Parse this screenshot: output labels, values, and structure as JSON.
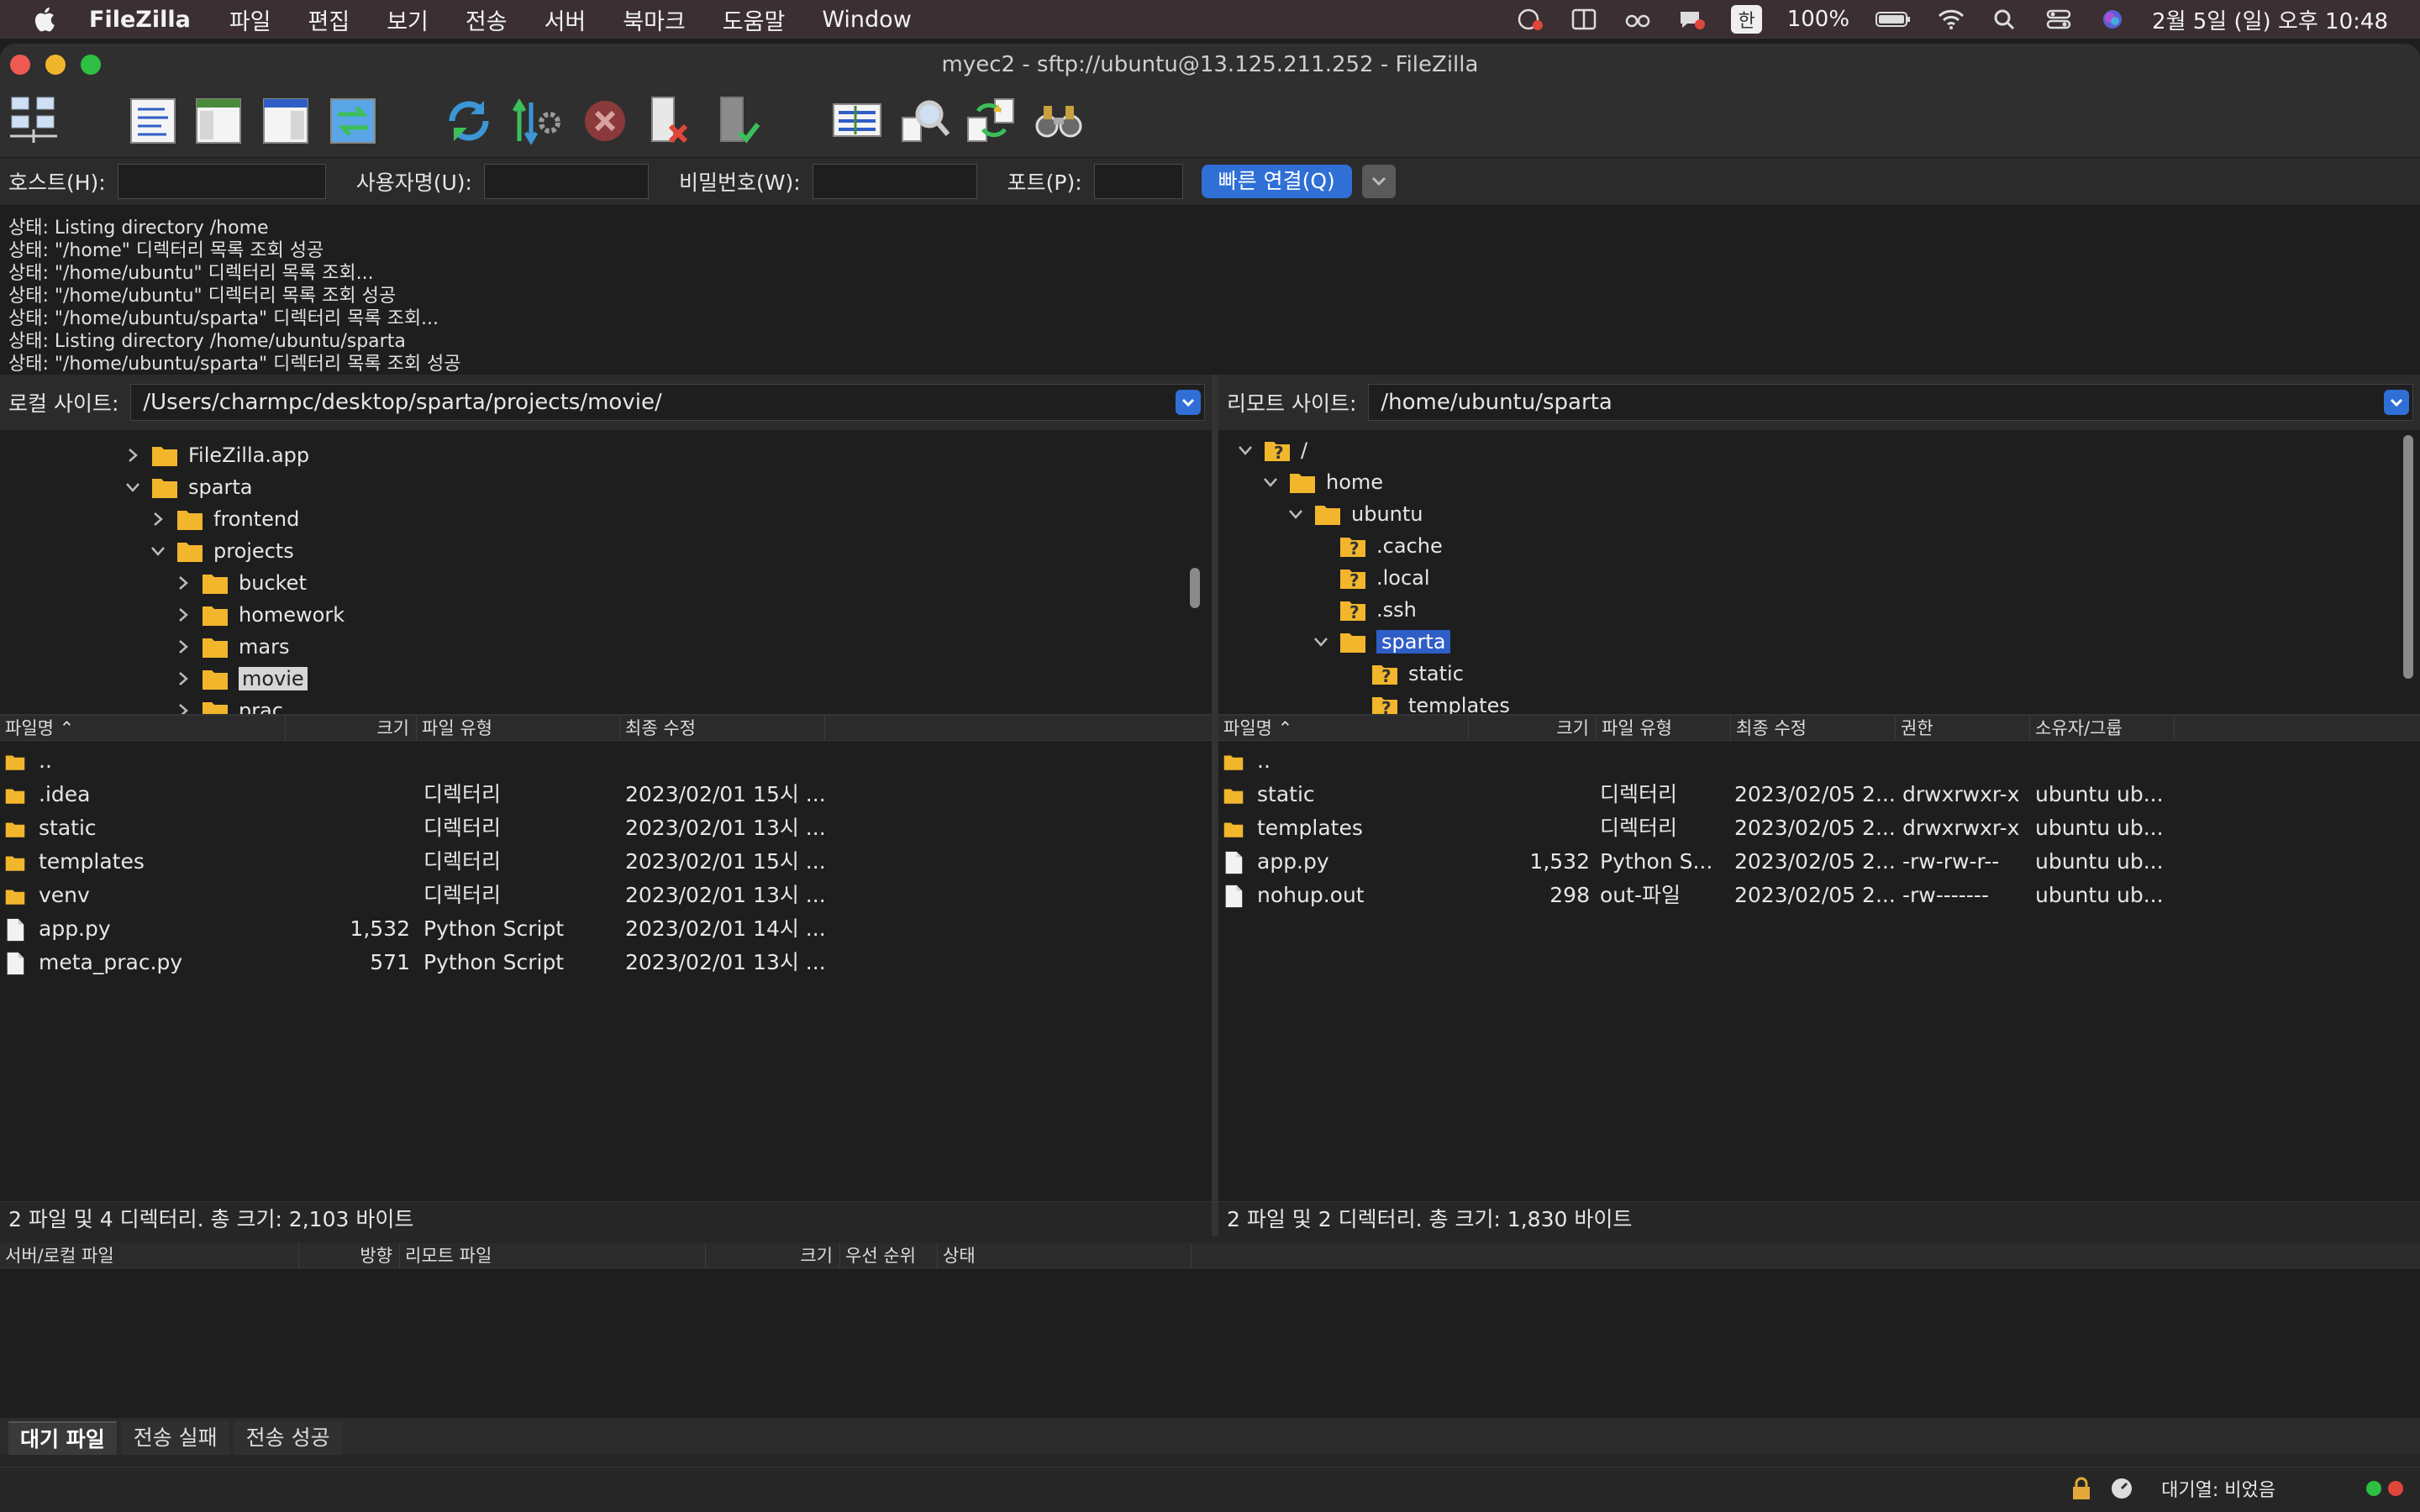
{
  "menubar": {
    "app": "FileZilla",
    "items": [
      "파일",
      "편집",
      "보기",
      "전송",
      "서버",
      "북마크",
      "도움말",
      "Window"
    ],
    "battery": "100%",
    "han": "한",
    "clock": "2월 5일 (일) 오후 10:48"
  },
  "window": {
    "title": "myec2 - sftp://ubuntu@13.125.211.252 - FileZilla"
  },
  "quickconnect": {
    "host_label": "호스트(H):",
    "user_label": "사용자명(U):",
    "pass_label": "비밀번호(W):",
    "port_label": "포트(P):",
    "connect_label": "빠른 연결(Q)"
  },
  "log": [
    "상태:  Listing directory /home",
    "상태:  \"/home\" 디렉터리 목록 조회 성공",
    "상태:  \"/home/ubuntu\" 디렉터리 목록 조회...",
    "상태:  \"/home/ubuntu\" 디렉터리 목록 조회 성공",
    "상태:  \"/home/ubuntu/sparta\" 디렉터리 목록 조회...",
    "상태:  Listing directory /home/ubuntu/sparta",
    "상태:  \"/home/ubuntu/sparta\" 디렉터리 목록 조회 성공"
  ],
  "local": {
    "label": "로컬 사이트:",
    "path": "/Users/charmpc/desktop/sparta/projects/movie/",
    "tree": [
      "FileZilla.app",
      "sparta",
      "frontend",
      "projects",
      "bucket",
      "homework",
      "mars",
      "movie",
      "prac"
    ],
    "columns": [
      "파일명",
      "크기",
      "파일 유형",
      "최종 수정"
    ],
    "files": [
      {
        "name": "..",
        "size": "",
        "type": "",
        "modified": ""
      },
      {
        "name": ".idea",
        "size": "",
        "type": "디렉터리",
        "modified": "2023/02/01 15시 ..."
      },
      {
        "name": "static",
        "size": "",
        "type": "디렉터리",
        "modified": "2023/02/01 13시 ..."
      },
      {
        "name": "templates",
        "size": "",
        "type": "디렉터리",
        "modified": "2023/02/01 15시 ..."
      },
      {
        "name": "venv",
        "size": "",
        "type": "디렉터리",
        "modified": "2023/02/01 13시 ..."
      },
      {
        "name": "app.py",
        "size": "1,532",
        "type": "Python Script",
        "modified": "2023/02/01 14시 ..."
      },
      {
        "name": "meta_prac.py",
        "size": "571",
        "type": "Python Script",
        "modified": "2023/02/01 13시 ..."
      }
    ],
    "summary": "2 파일 및 4 디렉터리. 총 크기: 2,103 바이트"
  },
  "remote": {
    "label": "리모트 사이트:",
    "path": "/home/ubuntu/sparta",
    "tree": [
      "/",
      "home",
      "ubuntu",
      ".cache",
      ".local",
      ".ssh",
      "sparta",
      "static",
      "templates"
    ],
    "columns": [
      "파일명",
      "크기",
      "파일 유형",
      "최종 수정",
      "권한",
      "소유자/그룹"
    ],
    "files": [
      {
        "name": "..",
        "size": "",
        "type": "",
        "modified": "",
        "perm": "",
        "owner": ""
      },
      {
        "name": "static",
        "size": "",
        "type": "디렉터리",
        "modified": "2023/02/05 2...",
        "perm": "drwxrwxr-x",
        "owner": "ubuntu ub..."
      },
      {
        "name": "templates",
        "size": "",
        "type": "디렉터리",
        "modified": "2023/02/05 2...",
        "perm": "drwxrwxr-x",
        "owner": "ubuntu ub..."
      },
      {
        "name": "app.py",
        "size": "1,532",
        "type": "Python S...",
        "modified": "2023/02/05 2...",
        "perm": "-rw-rw-r--",
        "owner": "ubuntu ub..."
      },
      {
        "name": "nohup.out",
        "size": "298",
        "type": "out-파일",
        "modified": "2023/02/05 2...",
        "perm": "-rw-------",
        "owner": "ubuntu ub..."
      }
    ],
    "summary": "2 파일 및 2 디렉터리. 총 크기: 1,830 바이트"
  },
  "queue": {
    "columns": [
      "서버/로컬 파일",
      "방향",
      "리모트 파일",
      "크기",
      "우선 순위",
      "상태"
    ],
    "tabs": [
      "대기 파일",
      "전송 실패",
      "전송 성공"
    ]
  },
  "statusbar": {
    "queue_text": "대기열: 비었음"
  },
  "colors": {
    "accent": "#2f6fd6",
    "folder": "#f2b62d",
    "selection": "#2f5ec6"
  }
}
